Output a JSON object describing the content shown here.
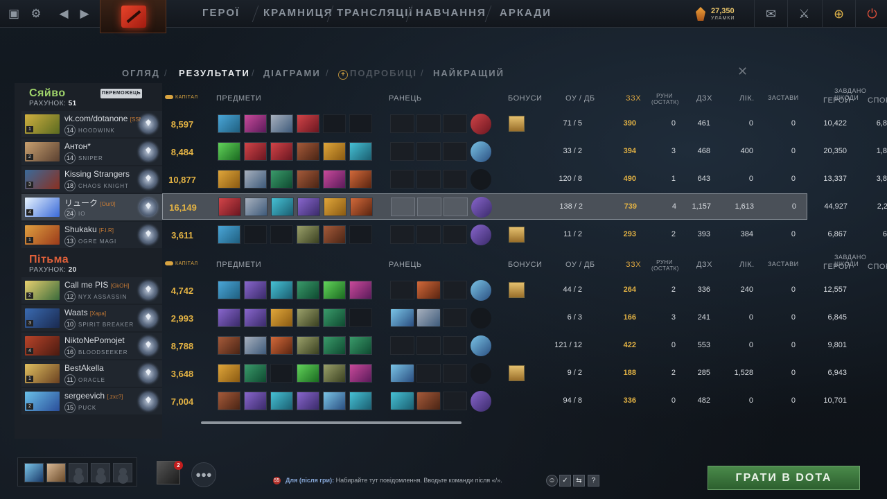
{
  "topbar": {
    "nav": [
      "ГЕРОЇ",
      "КРАМНИЦЯ",
      "ТРАНСЛЯЦІЇ",
      "НАВЧАННЯ",
      "АРКАДИ"
    ],
    "currency_amount": "27,350",
    "currency_label": "УЛАМКИ"
  },
  "tabs": [
    "ОГЛЯД",
    "РЕЗУЛЬТАТИ",
    "ДІАГРАМИ",
    "ПОДРОБИЦІ",
    "НАЙКРАЩИЙ"
  ],
  "active_tab": "РЕЗУЛЬТАТИ",
  "headers": {
    "networth": "КАПІТАЛ",
    "items": "ПРЕДМЕТИ",
    "backpack": "РАНЕЦЬ",
    "buffs": "БОНУСИ",
    "kills_deaths": "ОУ / ДБ",
    "gpm": "ЗЗХ",
    "runes": "РУНИ (ОСТАТК)",
    "xpm": "ДЗХ",
    "healing": "ЛІК.",
    "wards": "ЗАСТАВИ",
    "hero_damage_top": "ЗАВДАНО ШКОДИ",
    "hero_damage": "ГЕРОЙ",
    "building_damage": "СПОР"
  },
  "radiant": {
    "name": "Сяйво",
    "score_label": "РАХУНОК:",
    "score": "51",
    "winner_label": "ПЕРЕМОЖЕЦЬ",
    "players": [
      {
        "name": "vk.com/dotanone",
        "tag": "[SSMO]",
        "level": "14",
        "hero": "HOODWINK",
        "networth": "8,597",
        "kd": "71 / 5",
        "gpm": "390",
        "runes": "0",
        "xpm": "461",
        "heal": "0",
        "wards": "0",
        "hero_dmg": "10,422",
        "bld_dmg": "6,8"
      },
      {
        "name": "Антон*",
        "tag": "",
        "level": "14",
        "hero": "SNIPER",
        "networth": "8,484",
        "kd": "33 / 2",
        "gpm": "394",
        "runes": "3",
        "xpm": "468",
        "heal": "400",
        "wards": "0",
        "hero_dmg": "20,350",
        "bld_dmg": "1,8"
      },
      {
        "name": "Kissing Strangers",
        "tag": "",
        "level": "18",
        "hero": "CHAOS KNIGHT",
        "networth": "10,877",
        "kd": "120 / 8",
        "gpm": "490",
        "runes": "1",
        "xpm": "643",
        "heal": "0",
        "wards": "0",
        "hero_dmg": "13,337",
        "bld_dmg": "3,8"
      },
      {
        "name": "リューク",
        "tag": "[Our0]",
        "level": "24",
        "hero": "IO",
        "networth": "16,149",
        "kd": "138 / 2",
        "gpm": "739",
        "runes": "4",
        "xpm": "1,157",
        "heal": "1,613",
        "wards": "0",
        "hero_dmg": "44,927",
        "bld_dmg": "2,2"
      },
      {
        "name": "Shukaku",
        "tag": "[F.I.R]",
        "level": "13",
        "hero": "OGRE MAGI",
        "networth": "3,611",
        "kd": "11 / 2",
        "gpm": "293",
        "runes": "2",
        "xpm": "393",
        "heal": "384",
        "wards": "0",
        "hero_dmg": "6,867",
        "bld_dmg": "6"
      }
    ]
  },
  "dire": {
    "name": "Пітьма",
    "score_label": "РАХУНОК:",
    "score": "20",
    "players": [
      {
        "name": "Call me PIS",
        "tag": "[GkOH]",
        "level": "12",
        "hero": "NYX ASSASSIN",
        "networth": "4,742",
        "kd": "44 / 2",
        "gpm": "264",
        "runes": "2",
        "xpm": "336",
        "heal": "240",
        "wards": "0",
        "hero_dmg": "12,557",
        "bld_dmg": ""
      },
      {
        "name": "Waats",
        "tag": "[Хара]",
        "level": "10",
        "hero": "SPIRIT BREAKER",
        "networth": "2,993",
        "kd": "6 / 3",
        "gpm": "166",
        "runes": "3",
        "xpm": "241",
        "heal": "0",
        "wards": "0",
        "hero_dmg": "6,845",
        "bld_dmg": ""
      },
      {
        "name": "NiktoNePomojet",
        "tag": "",
        "level": "16",
        "hero": "BLOODSEEKER",
        "networth": "8,788",
        "kd": "121 / 12",
        "gpm": "422",
        "runes": "0",
        "xpm": "553",
        "heal": "0",
        "wards": "0",
        "hero_dmg": "9,801",
        "bld_dmg": ""
      },
      {
        "name": "BestAkella",
        "tag": "",
        "level": "11",
        "hero": "ORACLE",
        "networth": "3,648",
        "kd": "9 / 2",
        "gpm": "188",
        "runes": "2",
        "xpm": "285",
        "heal": "1,528",
        "wards": "0",
        "hero_dmg": "6,943",
        "bld_dmg": ""
      },
      {
        "name": "sergeevich",
        "tag": "[.zxc?]",
        "level": "15",
        "hero": "PUCK",
        "networth": "7,004",
        "kd": "94 / 8",
        "gpm": "336",
        "runes": "0",
        "xpm": "482",
        "heal": "0",
        "wards": "0",
        "hero_dmg": "10,701",
        "bld_dmg": ""
      }
    ]
  },
  "chat": {
    "channel": "Для (після гри):",
    "placeholder": "Набирайте тут повідомлення. Вводьте команди після «/».",
    "badge": "55"
  },
  "notification_count": "2",
  "play_button": "ГРАТИ В DOTA"
}
